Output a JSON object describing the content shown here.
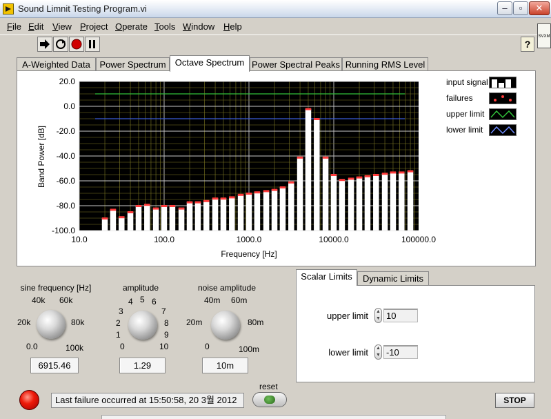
{
  "window": {
    "title": "Sound Limnit Testing Program.vi"
  },
  "menu": [
    "File",
    "Edit",
    "View",
    "Project",
    "Operate",
    "Tools",
    "Window",
    "Help"
  ],
  "toolbar": {
    "help_label": "?",
    "vi_icon_text": "SVXM"
  },
  "tabs": [
    {
      "label": "A-Weighted Data",
      "active": false
    },
    {
      "label": "Power Spectrum",
      "active": false
    },
    {
      "label": "Octave Spectrum",
      "active": true
    },
    {
      "label": "Power Spectral Peaks",
      "active": false
    },
    {
      "label": "Running RMS Level",
      "active": false
    }
  ],
  "legend": [
    {
      "label": "input signal",
      "icon": "bar-icon"
    },
    {
      "label": "failures",
      "icon": "dots-icon"
    },
    {
      "label": "upper limit",
      "icon": "wave-green-icon"
    },
    {
      "label": "lower limit",
      "icon": "wave-blue-icon"
    }
  ],
  "chart_data": {
    "type": "bar",
    "xlabel": "Frequency [Hz]",
    "ylabel": "Band Power [dB]",
    "xscale": "log",
    "xlim": [
      10,
      100000
    ],
    "ylim": [
      -100,
      20
    ],
    "x_ticks": [
      "10.0",
      "100.0",
      "1000.0",
      "10000.0",
      "100000.0"
    ],
    "y_ticks": [
      "20.0",
      "0.0",
      "-20.0",
      "-40.0",
      "-60.0",
      "-80.0",
      "-100.0"
    ],
    "grid": true,
    "upper_limit": 10,
    "lower_limit": -10,
    "series": [
      {
        "name": "input signal",
        "x": [
          20,
          25,
          31.5,
          40,
          50,
          63,
          80,
          100,
          125,
          160,
          200,
          250,
          315,
          400,
          500,
          630,
          800,
          1000,
          1250,
          1600,
          2000,
          2500,
          3150,
          4000,
          5000,
          6300,
          8000,
          10000,
          12500,
          16000,
          20000,
          25000,
          31500,
          40000,
          50000,
          63000,
          80000
        ],
        "values": [
          -90,
          -83,
          -89,
          -85,
          -80,
          -79,
          -82,
          -80,
          -80,
          -82,
          -77,
          -77,
          -76,
          -74,
          -74,
          -73,
          -71,
          -70,
          -69,
          -68,
          -67,
          -65,
          -61,
          -41,
          -2,
          -10,
          -41,
          -55,
          -59,
          -58,
          -57,
          -56,
          -55,
          -54,
          -53,
          -53,
          -52
        ],
        "color": "#ffffff"
      }
    ],
    "failure_color": "#ff3b3b",
    "upper_limit_color": "#31c13a",
    "lower_limit_color": "#3b5bd6"
  },
  "controls": {
    "sine_frequency": {
      "label": "sine frequency [Hz]",
      "scale": [
        "0.0",
        "20k",
        "40k",
        "60k",
        "80k",
        "100k"
      ],
      "value": "6915.46"
    },
    "amplitude": {
      "label": "amplitude",
      "scale": [
        "0",
        "1",
        "2",
        "3",
        "4",
        "5",
        "6",
        "7",
        "8",
        "9",
        "10"
      ],
      "value": "1.29"
    },
    "noise_amplitude": {
      "label": "noise amplitude",
      "scale": [
        "0",
        "20m",
        "40m",
        "60m",
        "80m",
        "100m"
      ],
      "value": "10m"
    }
  },
  "limits": {
    "tabs": [
      {
        "label": "Scalar Limits",
        "active": true
      },
      {
        "label": "Dynamic Limits",
        "active": false
      }
    ],
    "upper_label": "upper limit",
    "upper_value": "10",
    "lower_label": "lower limit",
    "lower_value": "-10"
  },
  "status": {
    "message": "Last failure occurred at 15:50:58, 20 3월 2012",
    "reset_label": "reset",
    "stop_label": "STOP"
  }
}
